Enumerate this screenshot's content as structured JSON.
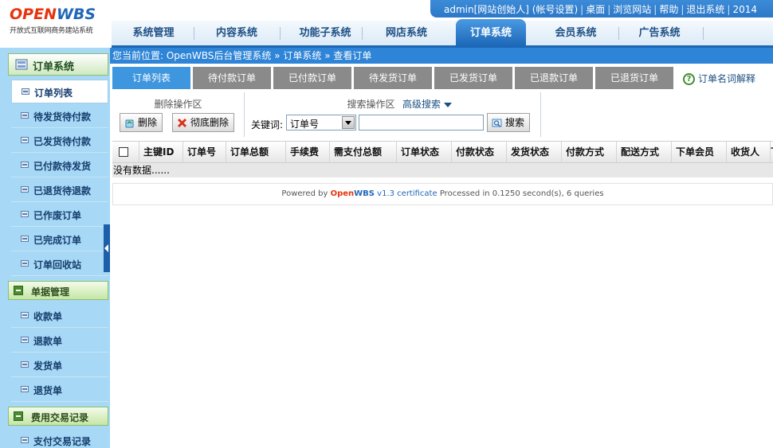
{
  "header": {
    "logo_open": "OPEN",
    "logo_wbs": "WBS",
    "logo_subtitle": "开放式互联网商务建站系统",
    "top_links": [
      "admin[网站创始人] (帐号设置)",
      "桌面",
      "浏览网站",
      "帮助",
      "退出系统",
      "2014"
    ]
  },
  "nav": {
    "items": [
      "系统管理",
      "内容系统",
      "功能子系统",
      "网店系统",
      "订单系统",
      "会员系统",
      "广告系统"
    ],
    "active": "订单系统"
  },
  "sidebar": {
    "title": "订单系统",
    "items": [
      "订单列表",
      "待发货待付款",
      "已发货待付款",
      "已付款待发货",
      "已退货待退款",
      "已作废订单",
      "已完成订单",
      "订单回收站"
    ],
    "section2": "单据管理",
    "items2": [
      "收款单",
      "退款单",
      "发货单",
      "退货单"
    ],
    "section3": "费用交易记录",
    "items3": [
      "支付交易记录"
    ]
  },
  "breadcrumb": "您当前位置: OpenWBS后台管理系统 » 订单系统 » 查看订单",
  "tabs": {
    "items": [
      "订单列表",
      "待付款订单",
      "已付款订单",
      "待发货订单",
      "已发货订单",
      "已退款订单",
      "已退货订单"
    ],
    "help": "订单名词解释"
  },
  "operations": {
    "delete_title": "删除操作区",
    "delete_btn": "删除",
    "purge_btn": "彻底删除",
    "search_title": "搜索操作区",
    "advanced": "高级搜索",
    "keyword_label": "关键词:",
    "field_selected": "订单号",
    "keyword_value": "",
    "search_btn": "搜索"
  },
  "grid": {
    "columns": [
      "主键ID",
      "订单号",
      "订单总额",
      "手续费",
      "需支付总额",
      "订单状态",
      "付款状态",
      "发货状态",
      "付款方式",
      "配送方式",
      "下单会员",
      "收货人",
      "下"
    ],
    "empty_text": "没有数据......"
  },
  "footer": {
    "prefix": "Powered by",
    "brand_open": "Open",
    "brand_wbs": "WBS",
    "version": "v1.3 certificate",
    "stats": "Processed in 0.1250 second(s), 6 queries"
  },
  "colors": {
    "accent": "#2e84d6",
    "tab_inactive": "#8a8a8a",
    "sidebar_bg": "#a7d8f5",
    "logo_orange": "#e8330f"
  }
}
